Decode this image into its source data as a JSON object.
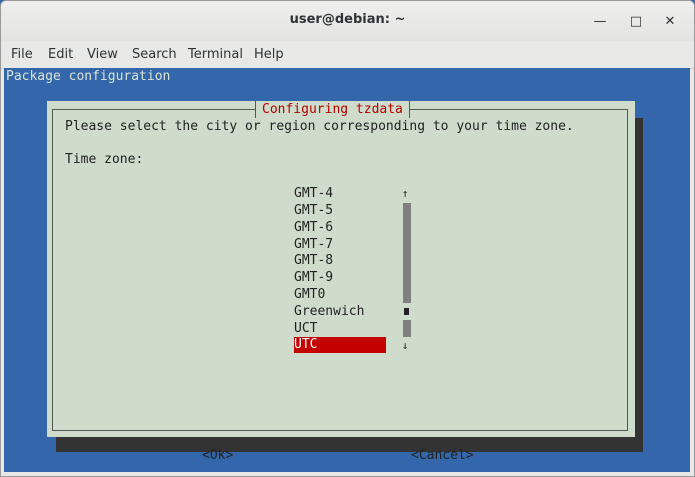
{
  "window": {
    "title": "user@debian: ~",
    "controls": {
      "minimize": "—",
      "maximize": "□",
      "close": "✕"
    }
  },
  "menubar": {
    "items": [
      "File",
      "Edit",
      "View",
      "Search",
      "Terminal",
      "Help"
    ]
  },
  "terminal": {
    "header": "Package configuration",
    "colors": {
      "background": "#3366aa",
      "dialog": "#cfdccb",
      "accent": "#c40000"
    }
  },
  "dialog": {
    "title": "Configuring tzdata",
    "prompt": "Please select the city or region corresponding to your time zone.",
    "label": "Time zone:",
    "items": [
      "GMT-4",
      "GMT-5",
      "GMT-6",
      "GMT-7",
      "GMT-8",
      "GMT-9",
      "GMT0",
      "Greenwich",
      "UCT",
      "UTC"
    ],
    "selected_index": 9,
    "scroll_up": "↑",
    "scroll_down": "↓",
    "ok_label": "<Ok>",
    "cancel_label": "<Cancel>"
  }
}
